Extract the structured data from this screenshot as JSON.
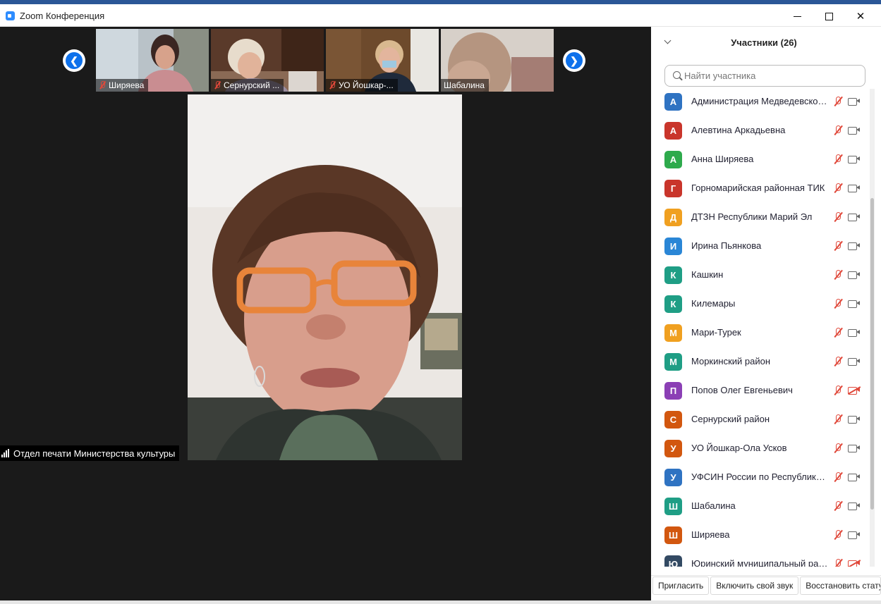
{
  "window": {
    "title": "Zoom Конференция"
  },
  "thumbnails": [
    {
      "name": "Ширяева",
      "muted": true
    },
    {
      "name": "Сернурский ...",
      "muted": true
    },
    {
      "name": "УО Йошкар-...",
      "muted": true
    },
    {
      "name": "Шабалина",
      "muted": false
    }
  ],
  "main_video": {
    "speaker_label": "Отдел печати Министерства культуры"
  },
  "panel": {
    "title": "Участники (26)",
    "search_placeholder": "Найти участника",
    "participants": [
      {
        "initial": "А",
        "name": "Администрация Медведевского...",
        "color": "#2f73c2",
        "muted": true,
        "video_off": false
      },
      {
        "initial": "А",
        "name": "Алевтина Аркадьевна",
        "color": "#c9352b",
        "muted": true,
        "video_off": false
      },
      {
        "initial": "А",
        "name": "Анна Ширяева",
        "color": "#2eaa4c",
        "muted": true,
        "video_off": false
      },
      {
        "initial": "Г",
        "name": "Горномарийская районная ТИК",
        "color": "#c9352b",
        "muted": true,
        "video_off": false
      },
      {
        "initial": "Д",
        "name": "ДТЗН Республики Марий Эл",
        "color": "#f0a020",
        "muted": true,
        "video_off": false
      },
      {
        "initial": "И",
        "name": "Ирина Пьянкова",
        "color": "#2a86d6",
        "muted": true,
        "video_off": false
      },
      {
        "initial": "К",
        "name": "Кашкин",
        "color": "#1f9e85",
        "muted": true,
        "video_off": false
      },
      {
        "initial": "К",
        "name": "Килемары",
        "color": "#1f9e85",
        "muted": true,
        "video_off": false
      },
      {
        "initial": "М",
        "name": "Мари-Турек",
        "color": "#f0a020",
        "muted": true,
        "video_off": false
      },
      {
        "initial": "М",
        "name": "Моркинский район",
        "color": "#1f9e85",
        "muted": true,
        "video_off": false
      },
      {
        "initial": "П",
        "name": "Попов Олег Евгеньевич",
        "color": "#8b3fb5",
        "muted": true,
        "video_off": true
      },
      {
        "initial": "С",
        "name": "Сернурский район",
        "color": "#d2570f",
        "muted": true,
        "video_off": false
      },
      {
        "initial": "У",
        "name": "УО Йошкар-Ола Усков",
        "color": "#d2570f",
        "muted": true,
        "video_off": false
      },
      {
        "initial": "У",
        "name": "УФСИН России по Республике ...",
        "color": "#2f73c2",
        "muted": true,
        "video_off": false
      },
      {
        "initial": "Ш",
        "name": "Шабалина",
        "color": "#1f9e85",
        "muted": true,
        "video_off": false
      },
      {
        "initial": "Ш",
        "name": "Ширяева",
        "color": "#d2570f",
        "muted": true,
        "video_off": false
      },
      {
        "initial": "Ю",
        "name": "Юринский муниципальный рай...",
        "color": "#334a63",
        "muted": true,
        "video_off": true
      }
    ],
    "footer": {
      "invite": "Пригласить",
      "unmute_self": "Включить свой звук",
      "restore": "Восстановить стату"
    }
  }
}
